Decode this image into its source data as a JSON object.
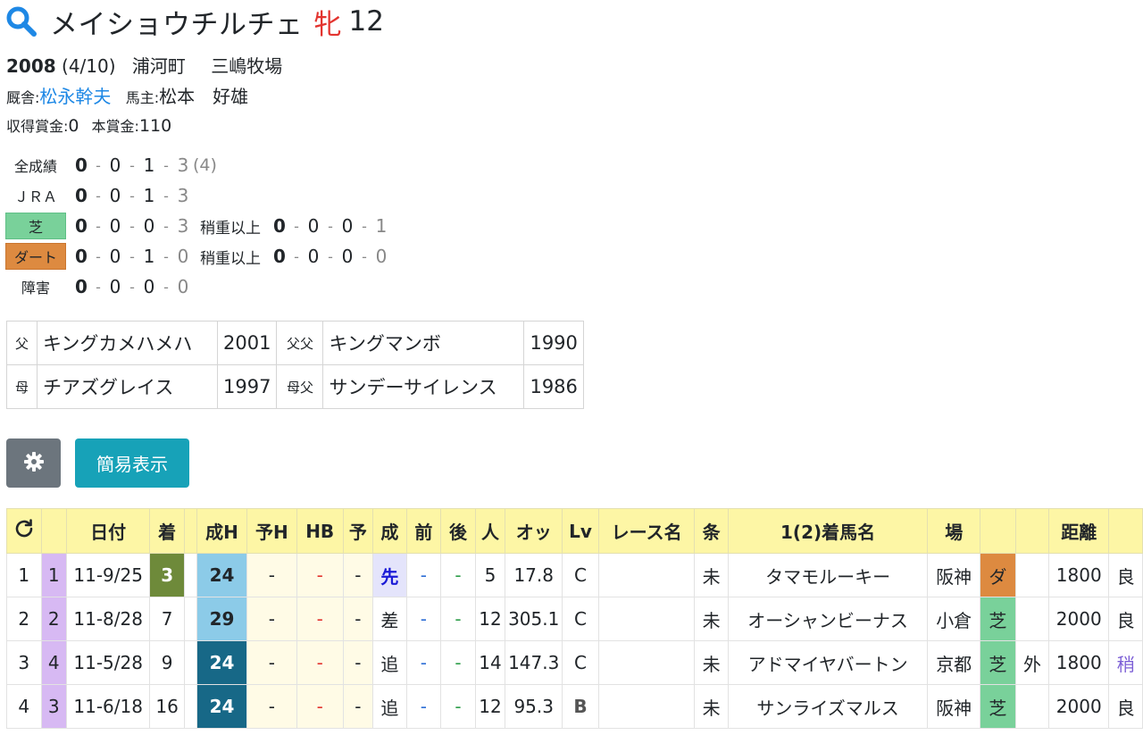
{
  "horse": {
    "name": "メイショウチルチェ",
    "sex": "牝",
    "age": "12"
  },
  "birth": {
    "year": "2008",
    "date": "(4/10)",
    "place": "浦河町",
    "farm": "三嶋牧場"
  },
  "stable": {
    "label": "厩舎:",
    "trainer": "松永幹夫",
    "owner_label": "馬主:",
    "owner": "松本　好雄"
  },
  "prize": {
    "earned_label": "収得賞金:",
    "earned": "0",
    "main_label": "本賞金:",
    "main": "110"
  },
  "records": [
    {
      "label": "全成績",
      "style": "plain",
      "vals": [
        "0",
        "0",
        "1",
        "3"
      ],
      "extra": "(4)"
    },
    {
      "label": "ＪＲＡ",
      "style": "plain",
      "vals": [
        "0",
        "0",
        "1",
        "3"
      ]
    },
    {
      "label": "芝",
      "style": "turf",
      "vals": [
        "0",
        "0",
        "0",
        "3"
      ],
      "heavy_label": "稍重以上",
      "heavy": [
        "0",
        "0",
        "0",
        "1"
      ]
    },
    {
      "label": "ダート",
      "style": "dirt",
      "vals": [
        "0",
        "0",
        "1",
        "0"
      ],
      "heavy_label": "稍重以上",
      "heavy": [
        "0",
        "0",
        "0",
        "0"
      ]
    },
    {
      "label": "障害",
      "style": "plain",
      "vals": [
        "0",
        "0",
        "0",
        "0"
      ]
    }
  ],
  "pedigree": {
    "sire_key": "父",
    "sire": "キングカメハメハ",
    "sire_year": "2001",
    "sire_sire_key": "父父",
    "sire_sire": "キングマンボ",
    "sire_sire_year": "1990",
    "dam_key": "母",
    "dam": "チアズグレイス",
    "dam_year": "1997",
    "dam_sire_key": "母父",
    "dam_sire": "サンデーサイレンス",
    "dam_sire_year": "1986"
  },
  "buttons": {
    "settings_icon": "gear-icon",
    "simple_view": "簡易表示"
  },
  "table": {
    "refresh_icon": "refresh-icon",
    "headers": [
      "",
      "日付",
      "着",
      "",
      "成H",
      "予H",
      "HB",
      "予",
      "成",
      "前",
      "後",
      "人",
      "オッ",
      "Lv",
      "レース名",
      "条",
      "1(2)着馬名",
      "場",
      "",
      "",
      "距離",
      ""
    ],
    "rows": [
      {
        "no": "1",
        "post": "1",
        "date": "11-9/25",
        "finish": "3",
        "sei_h": "24",
        "yo_h": "-",
        "hb": "-",
        "yo": "-",
        "sei": "先",
        "mae": "-",
        "ato": "-",
        "pop": "5",
        "odds": "17.8",
        "lv": "C",
        "race": "",
        "cls": "未",
        "opp": "タマモルーキー",
        "course": "阪神",
        "surface": "ダ",
        "side": "",
        "dist": "1800",
        "cond": "良"
      },
      {
        "no": "2",
        "post": "2",
        "date": "11-8/28",
        "finish": "7",
        "sei_h": "29",
        "yo_h": "-",
        "hb": "-",
        "yo": "-",
        "sei": "差",
        "mae": "-",
        "ato": "-",
        "pop": "12",
        "odds": "305.1",
        "lv": "C",
        "race": "",
        "cls": "未",
        "opp": "オーシャンビーナス",
        "course": "小倉",
        "surface": "芝",
        "side": "",
        "dist": "2000",
        "cond": "良"
      },
      {
        "no": "3",
        "post": "4",
        "date": "11-5/28",
        "finish": "9",
        "sei_h": "24",
        "yo_h": "-",
        "hb": "-",
        "yo": "-",
        "sei": "追",
        "mae": "-",
        "ato": "-",
        "pop": "14",
        "odds": "147.3",
        "lv": "C",
        "race": "",
        "cls": "未",
        "opp": "アドマイヤバートン",
        "course": "京都",
        "surface": "芝",
        "side": "外",
        "dist": "1800",
        "cond": "稍"
      },
      {
        "no": "4",
        "post": "3",
        "date": "11-6/18",
        "finish": "16",
        "sei_h": "24",
        "yo_h": "-",
        "hb": "-",
        "yo": "-",
        "sei": "追",
        "mae": "-",
        "ato": "-",
        "pop": "12",
        "odds": "95.3",
        "lv": "B",
        "race": "",
        "cls": "未",
        "opp": "サンライズマルス",
        "course": "阪神",
        "surface": "芝",
        "side": "",
        "dist": "2000",
        "cond": "良"
      }
    ]
  }
}
